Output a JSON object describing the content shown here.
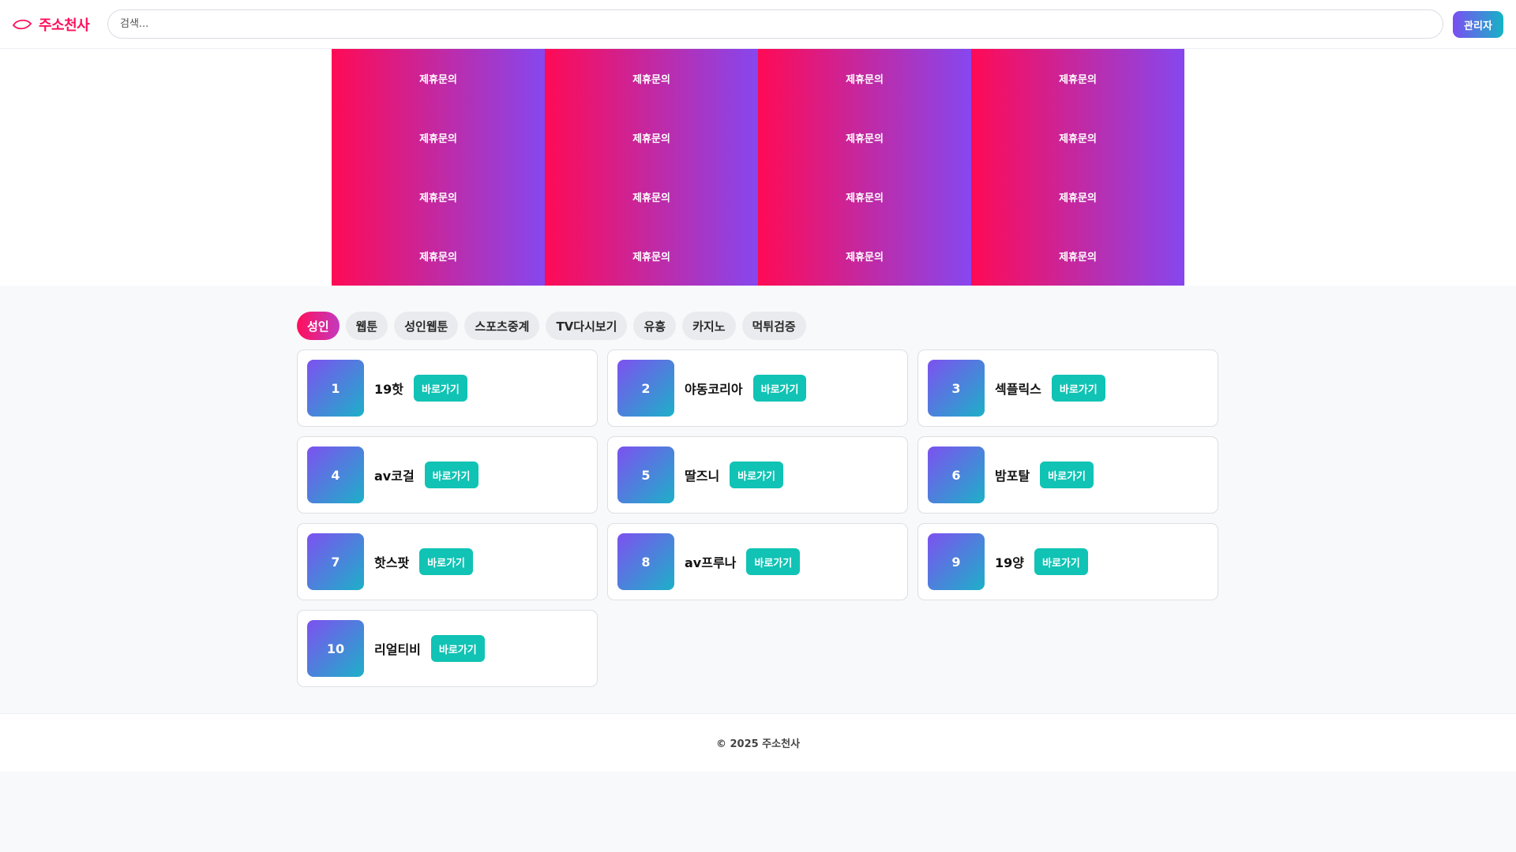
{
  "header": {
    "logo_text": "주소천사",
    "search_placeholder": "검색...",
    "admin_label": "관리자"
  },
  "banners": [
    "제휴문의",
    "제휴문의",
    "제휴문의",
    "제휴문의",
    "제휴문의",
    "제휴문의",
    "제휴문의",
    "제휴문의",
    "제휴문의",
    "제휴문의",
    "제휴문의",
    "제휴문의",
    "제휴문의",
    "제휴문의",
    "제휴문의",
    "제휴문의"
  ],
  "tabs": [
    {
      "label": "성인",
      "active": true
    },
    {
      "label": "웹툰",
      "active": false
    },
    {
      "label": "성인웹툰",
      "active": false
    },
    {
      "label": "스포츠중계",
      "active": false
    },
    {
      "label": "TV다시보기",
      "active": false
    },
    {
      "label": "유흥",
      "active": false
    },
    {
      "label": "카지노",
      "active": false
    },
    {
      "label": "먹튀검증",
      "active": false
    }
  ],
  "sites": [
    {
      "rank": "1",
      "name": "19핫",
      "button": "바로가기"
    },
    {
      "rank": "2",
      "name": "야동코리아",
      "button": "바로가기"
    },
    {
      "rank": "3",
      "name": "섹플릭스",
      "button": "바로가기"
    },
    {
      "rank": "4",
      "name": "av코걸",
      "button": "바로가기"
    },
    {
      "rank": "5",
      "name": "딸즈니",
      "button": "바로가기"
    },
    {
      "rank": "6",
      "name": "밤포탈",
      "button": "바로가기"
    },
    {
      "rank": "7",
      "name": "핫스팟",
      "button": "바로가기"
    },
    {
      "rank": "8",
      "name": "av프루나",
      "button": "바로가기"
    },
    {
      "rank": "9",
      "name": "19양",
      "button": "바로가기"
    },
    {
      "rank": "10",
      "name": "리얼티비",
      "button": "바로가기"
    }
  ],
  "footer": {
    "copyright": "© 2025 주소천사"
  },
  "colors": {
    "brand": "#ff0f5b",
    "accent_teal": "#10c3b4",
    "accent_purple": "#7b4ef2"
  },
  "icons": {
    "logo": "eye-logo-icon"
  }
}
